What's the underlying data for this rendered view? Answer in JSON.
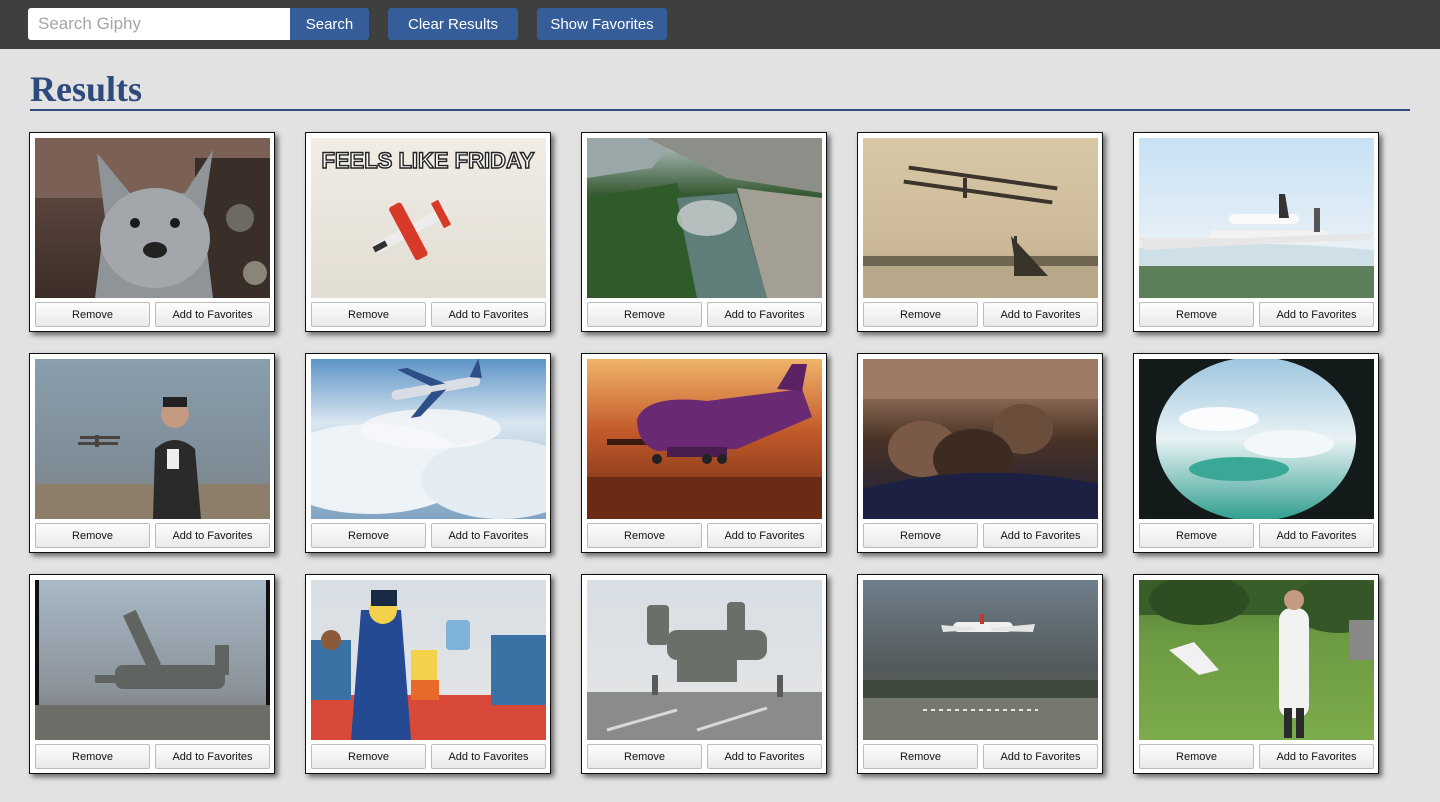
{
  "topbar": {
    "search_placeholder": "Search Giphy",
    "search_value": "",
    "search_label": "Search",
    "clear_label": "Clear Results",
    "favorites_label": "Show Favorites"
  },
  "results": {
    "title": "Results",
    "remove_label": "Remove",
    "favorite_label": "Add to Favorites",
    "items": [
      {
        "scene": "blue heeler dog",
        "caption": ""
      },
      {
        "scene": "stunt plane",
        "caption": "FEELS LIKE FRIDAY"
      },
      {
        "scene": "low flight over river",
        "caption": ""
      },
      {
        "scene": "vintage biplane",
        "caption": ""
      },
      {
        "scene": "shuttle carrier jet",
        "caption": ""
      },
      {
        "scene": "man and crop duster",
        "caption": ""
      },
      {
        "scene": "jet above clouds",
        "caption": ""
      },
      {
        "scene": "purple cargo plane",
        "caption": ""
      },
      {
        "scene": "cabin passengers",
        "caption": ""
      },
      {
        "scene": "porthole view",
        "caption": ""
      },
      {
        "scene": "tiltrotor aircraft",
        "caption": ""
      },
      {
        "scene": "cartoon flight attendant",
        "caption": ""
      },
      {
        "scene": "tiltrotor on runway",
        "caption": ""
      },
      {
        "scene": "airliner landing",
        "caption": ""
      },
      {
        "scene": "man on lawn",
        "caption": ""
      }
    ]
  },
  "colors": {
    "topbar": "#3f3f3f",
    "accent": "#345d99",
    "title": "#2c4a7c",
    "page_bg": "#e2e2e2"
  }
}
